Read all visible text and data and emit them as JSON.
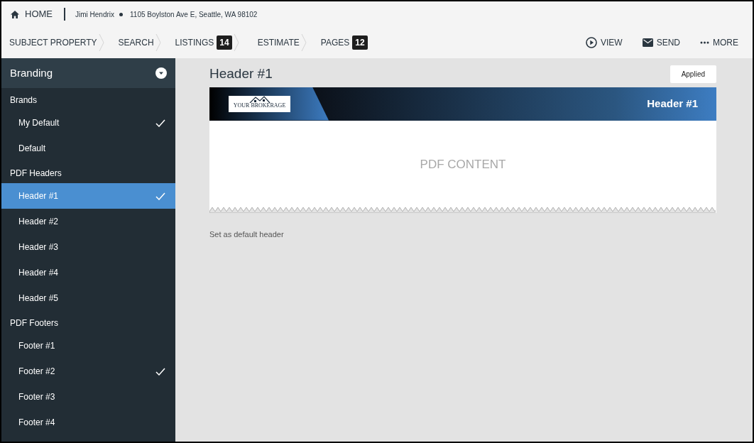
{
  "topbar": {
    "home": "HOME",
    "client": "Jimi Hendrix",
    "address": "1105 Boylston Ave E, Seattle, WA 98102"
  },
  "steps": [
    {
      "label": "SUBJECT PROPERTY"
    },
    {
      "label": "SEARCH"
    },
    {
      "label": "LISTINGS",
      "count": "14"
    },
    {
      "label": "ESTIMATE"
    },
    {
      "label": "PAGES",
      "count": "12"
    }
  ],
  "actions": [
    {
      "kind": "view",
      "label": "VIEW"
    },
    {
      "kind": "send",
      "label": "SEND"
    },
    {
      "kind": "more",
      "label": "MORE"
    }
  ],
  "sidebar": {
    "title": "Branding",
    "items": [
      {
        "kind": "section",
        "label": "Brands"
      },
      {
        "kind": "item",
        "label": "My Default",
        "selected": false,
        "checked": true
      },
      {
        "kind": "item",
        "label": "Default",
        "selected": false,
        "checked": false
      },
      {
        "kind": "section",
        "label": "PDF Headers"
      },
      {
        "kind": "item",
        "label": "Header #1",
        "selected": true,
        "checked": true
      },
      {
        "kind": "item",
        "label": "Header #2",
        "selected": false,
        "checked": false
      },
      {
        "kind": "item",
        "label": "Header #3",
        "selected": false,
        "checked": false
      },
      {
        "kind": "item",
        "label": "Header #4",
        "selected": false,
        "checked": false
      },
      {
        "kind": "item",
        "label": "Header #5",
        "selected": false,
        "checked": false
      },
      {
        "kind": "section",
        "label": "PDF Footers"
      },
      {
        "kind": "item",
        "label": "Footer #1",
        "selected": false,
        "checked": false
      },
      {
        "kind": "item",
        "label": "Footer #2",
        "selected": false,
        "checked": true
      },
      {
        "kind": "item",
        "label": "Footer #3",
        "selected": false,
        "checked": false
      },
      {
        "kind": "item",
        "label": "Footer #4",
        "selected": false,
        "checked": false
      }
    ]
  },
  "main": {
    "title": "Header #1",
    "status_button": "Applied",
    "preview": {
      "logo_text": "YOUR BROKERAGE",
      "header_title": "Header #1",
      "content": "PDF CONTENT"
    },
    "footer_link": "Set as default header"
  }
}
